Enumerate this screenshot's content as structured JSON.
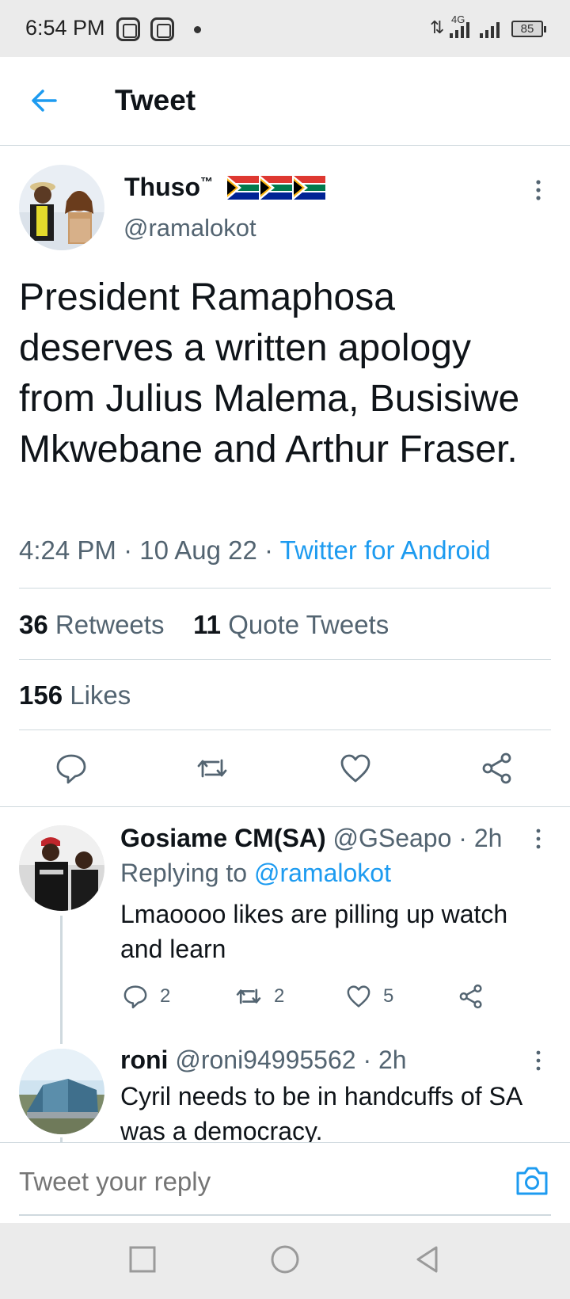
{
  "status_bar": {
    "time": "6:54 PM",
    "network": "4G",
    "battery": "85"
  },
  "header": {
    "back_icon": "arrow-left-icon",
    "title": "Tweet"
  },
  "tweet": {
    "author_name": "Thuso",
    "trademark": "™",
    "handle": "@ramalokot",
    "flags": [
      "south-africa-flag",
      "south-africa-flag",
      "south-africa-flag"
    ],
    "text": "President Ramaphosa deserves a written apology from Julius Malema, Busisiwe Mkwebane and Arthur Fraser.",
    "time": "4:24 PM",
    "date": "10 Aug 22",
    "source": "Twitter for Android",
    "retweets_count": "36",
    "retweets_label": "Retweets",
    "quotes_count": "11",
    "quotes_label": "Quote Tweets",
    "likes_count": "156",
    "likes_label": "Likes"
  },
  "replies": [
    {
      "name": "Gosiame CM(SA)",
      "handle": "@GSeapo",
      "time": "2h",
      "replying_prefix": "Replying to",
      "replying_to": "@ramalokot",
      "text": "Lmaoooo likes are pilling up watch and learn",
      "reply_count": "2",
      "retweet_count": "2",
      "like_count": "5"
    },
    {
      "name": "roni",
      "handle": "@roni94995562",
      "time": "2h",
      "text": "Cyril needs to be in handcuffs of SA was a democracy."
    }
  ],
  "composer": {
    "placeholder": "Tweet your reply"
  },
  "colors": {
    "accent": "#1d9bf0",
    "secondary_text": "#536471",
    "primary_text": "#0f1419",
    "divider": "#cfd9de"
  }
}
